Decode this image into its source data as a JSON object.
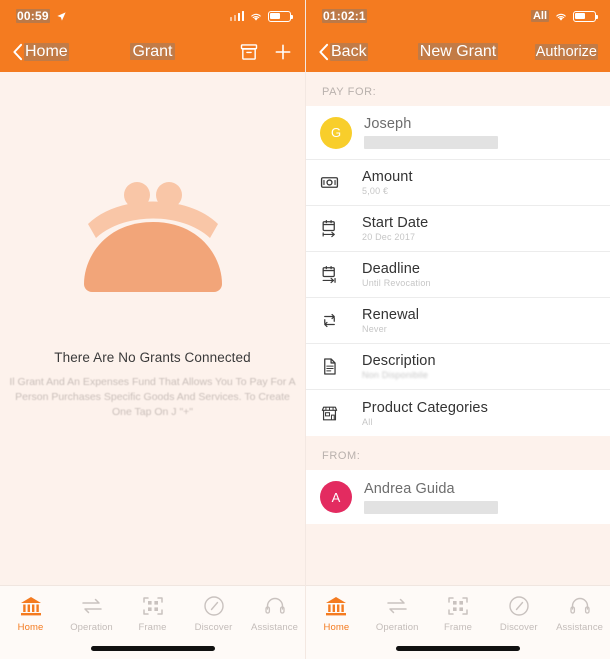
{
  "left_screen": {
    "status_bar": {
      "time": "00:59",
      "location_icon": "location-arrow-icon",
      "signal_icon": "signal-bars-icon",
      "wifi_icon": "wifi-icon",
      "battery_icon": "battery-icon"
    },
    "nav_bar": {
      "back_label": "Home",
      "title": "Grant",
      "archive_icon": "archive-box-icon",
      "add_icon": "plus-icon"
    },
    "empty_state": {
      "illustration": "coin-purse-icon",
      "title": "There Are No Grants Connected",
      "description": "Il Grant And An Expenses Fund That Allows You To Pay For A Person Purchases Specific Goods And Services. To Create One Tap On J \"+\""
    }
  },
  "right_screen": {
    "status_bar": {
      "time": "01:02:1",
      "carrier": "All",
      "wifi_icon": "wifi-icon",
      "battery_icon": "battery-icon"
    },
    "nav_bar": {
      "back_label": "Back",
      "title": "New Grant",
      "action_label": "Authorize"
    },
    "pay_for": {
      "section_label": "PAY FOR:",
      "person": {
        "avatar_letter": "G",
        "avatar_color": "#F8CE2B",
        "name": "Joseph"
      },
      "rows": [
        {
          "icon": "banknote-icon",
          "title": "Amount",
          "value": "5,00 €",
          "blurred": false
        },
        {
          "icon": "calendar-start-icon",
          "title": "Start Date",
          "value": "20 Dec 2017",
          "blurred": false
        },
        {
          "icon": "calendar-end-icon",
          "title": "Deadline",
          "value": "Until Revocation",
          "blurred": false
        },
        {
          "icon": "renewal-loop-icon",
          "title": "Renewal",
          "value": "Never",
          "blurred": false
        },
        {
          "icon": "document-icon",
          "title": "Description",
          "value": "Non Disponibile",
          "blurred": true
        },
        {
          "icon": "storefront-icon",
          "title": "Product Categories",
          "value": "All",
          "blurred": false
        }
      ]
    },
    "from": {
      "section_label": "FROM:",
      "person": {
        "avatar_letter": "A",
        "avatar_color": "#E32B60",
        "name": "Andrea Guida"
      }
    }
  },
  "tab_bar": {
    "items": [
      {
        "icon": "bank-icon",
        "label": "Home",
        "active": true
      },
      {
        "icon": "transfer-arrows-icon",
        "label": "Operation",
        "active": false
      },
      {
        "icon": "qr-frame-icon",
        "label": "Frame",
        "active": false
      },
      {
        "icon": "compass-icon",
        "label": "Discover",
        "active": false
      },
      {
        "icon": "headset-icon",
        "label": "Assistance",
        "active": false
      }
    ]
  },
  "colors": {
    "brand_orange": "#F47B20",
    "background": "#FDF2EC",
    "card": "#FFFFFF",
    "purse_body": "#F2A579",
    "purse_clasp": "#F9C6A7"
  }
}
